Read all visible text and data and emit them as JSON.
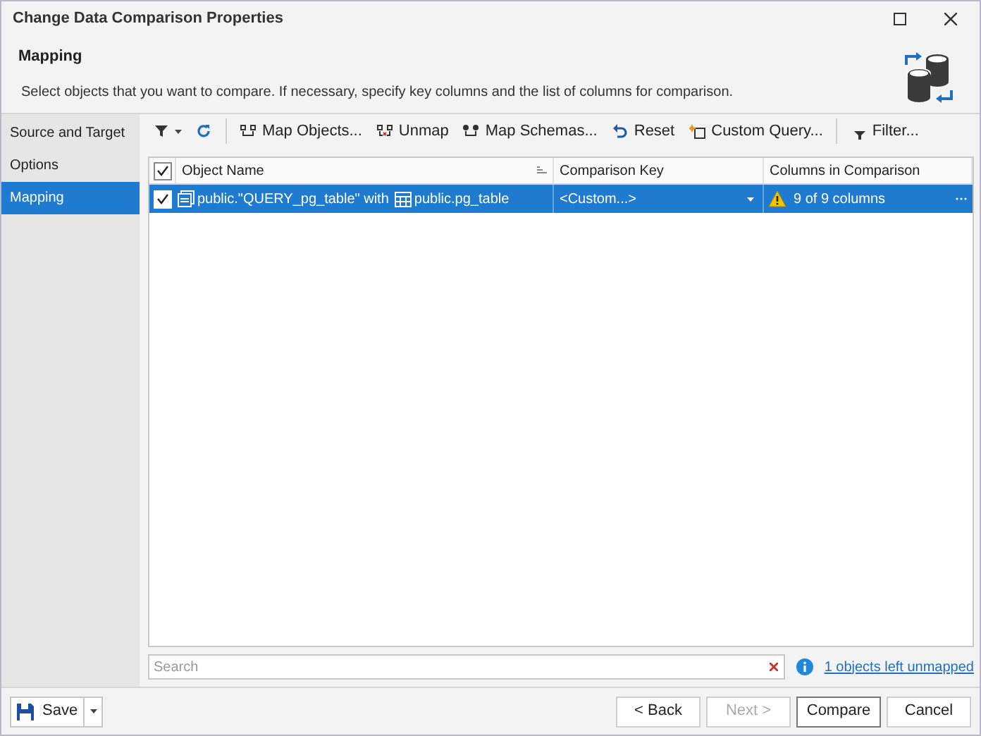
{
  "window": {
    "title": "Change Data Comparison Properties"
  },
  "header": {
    "title": "Mapping",
    "description": "Select objects that you want to compare. If necessary, specify key columns and the list of columns for comparison."
  },
  "sidebar": {
    "items": [
      {
        "label": "Source and Target",
        "selected": false
      },
      {
        "label": "Options",
        "selected": false
      },
      {
        "label": "Mapping",
        "selected": true
      }
    ]
  },
  "toolbar": [
    {
      "kind": "filter-dropdown"
    },
    {
      "kind": "refresh"
    },
    {
      "kind": "separator"
    },
    {
      "kind": "map",
      "label": "Map Objects..."
    },
    {
      "kind": "unmap",
      "label": "Unmap"
    },
    {
      "kind": "schemas",
      "label": "Map Schemas..."
    },
    {
      "kind": "reset",
      "label": "Reset"
    },
    {
      "kind": "query",
      "label": "Custom Query..."
    },
    {
      "kind": "separator"
    },
    {
      "kind": "sqlfilter",
      "label": "Filter..."
    }
  ],
  "grid": {
    "all_checked": true,
    "columns": [
      "Object Name",
      "Comparison Key",
      "Columns in Comparison"
    ],
    "rows": [
      {
        "checked": true,
        "selected": true,
        "source": "public.\"QUERY_pg_table\" with",
        "target": "public.pg_table",
        "key": "<Custom...>",
        "columns": "9 of 9 columns",
        "warning": true
      }
    ]
  },
  "search": {
    "placeholder": "Search"
  },
  "unmapped_link": "1 objects left unmapped",
  "footer": {
    "save": "Save",
    "buttons": [
      {
        "label": "< Back",
        "disabled": false,
        "default": false
      },
      {
        "label": "Next >",
        "disabled": true,
        "default": false
      },
      {
        "label": "Compare",
        "disabled": false,
        "default": true
      },
      {
        "label": "Cancel",
        "disabled": false,
        "default": false
      }
    ]
  }
}
